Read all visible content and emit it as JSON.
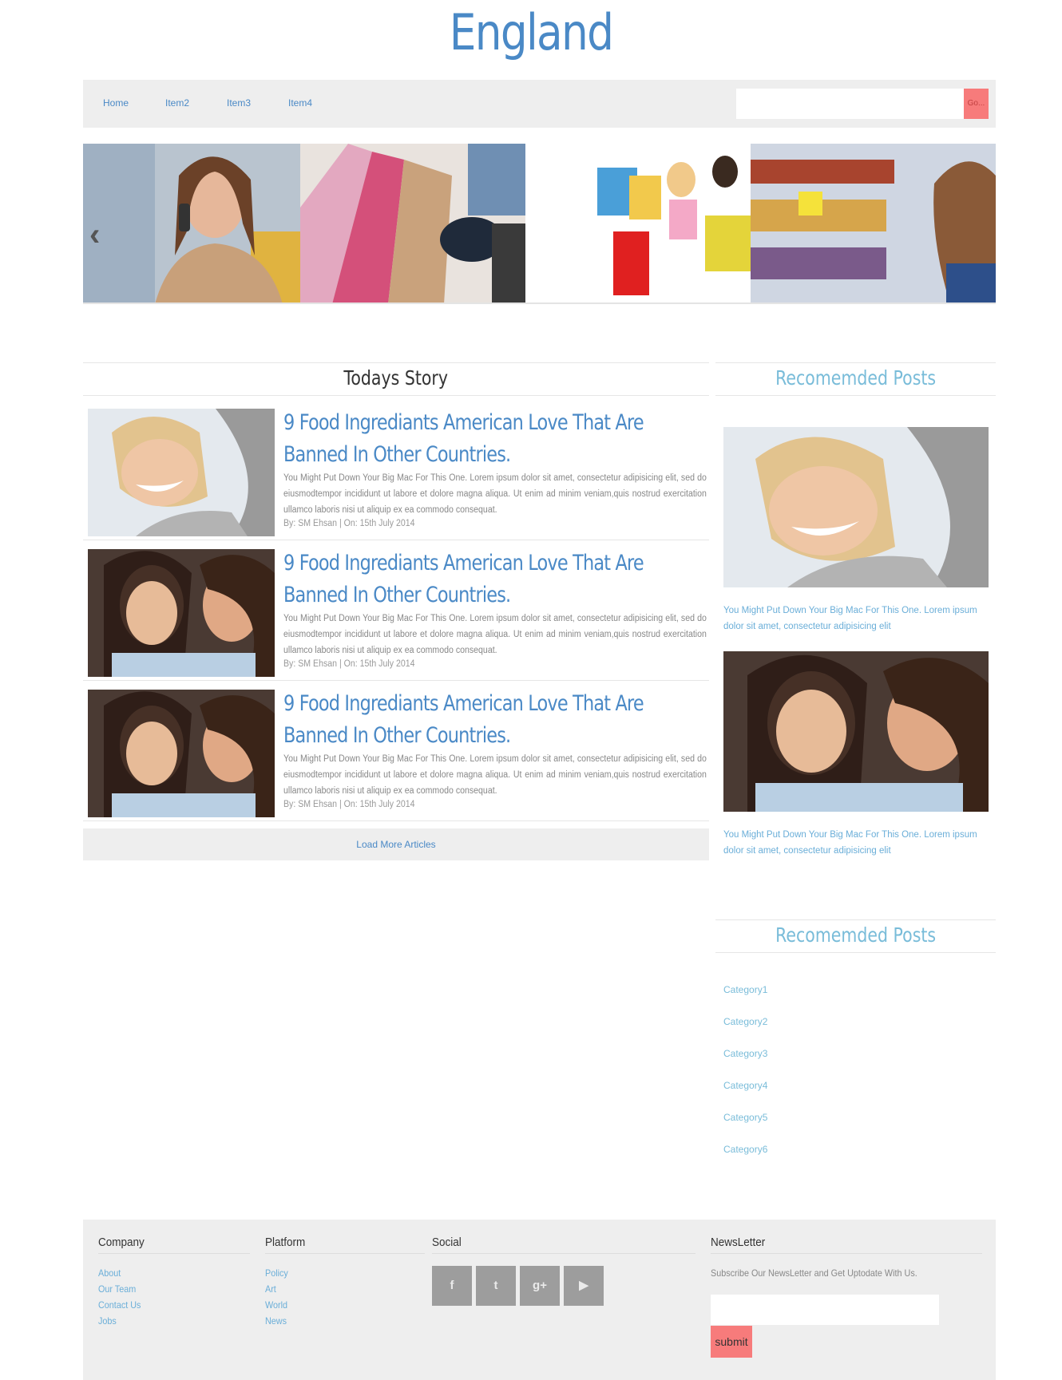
{
  "site": {
    "title": "England"
  },
  "nav": {
    "items": [
      "Home",
      "Item2",
      "Item3",
      "Item4"
    ],
    "search_placeholder": "",
    "go_label": "Go..."
  },
  "carousel": {
    "prev_icon": "chevron-left-icon"
  },
  "todays_story": {
    "heading": "Todays Story",
    "articles": [
      {
        "title": "9 Food Ingrediants American Love That Are Banned In Other Countries.",
        "body": "You Might Put Down Your Big Mac For This One. Lorem ipsum dolor sit amet, consectetur adipisicing elit, sed do eiusmodtempor incididunt ut labore et dolore magna aliqua. Ut enim ad minim veniam,quis nostrud exercitation ullamco laboris nisi ut aliquip ex ea commodo consequat.",
        "meta": "By: SM Ehsan | On: 15th July 2014"
      },
      {
        "title": "9 Food Ingrediants American Love That Are Banned In Other Countries.",
        "body": "You Might Put Down Your Big Mac For This One. Lorem ipsum dolor sit amet, consectetur adipisicing elit, sed do eiusmodtempor incididunt ut labore et dolore magna aliqua. Ut enim ad minim veniam,quis nostrud exercitation ullamco laboris nisi ut aliquip ex ea commodo consequat.",
        "meta": "By: SM Ehsan | On: 15th July 2014"
      },
      {
        "title": "9 Food Ingrediants American Love That Are Banned In Other Countries.",
        "body": "You Might Put Down Your Big Mac For This One. Lorem ipsum dolor sit amet, consectetur adipisicing elit, sed do eiusmodtempor incididunt ut labore et dolore magna aliqua. Ut enim ad minim veniam,quis nostrud exercitation ullamco laboris nisi ut aliquip ex ea commodo consequat.",
        "meta": "By: SM Ehsan | On: 15th July 2014"
      }
    ],
    "load_more": "Load More Articles"
  },
  "recommended": {
    "heading": "Recomemded Posts",
    "posts": [
      {
        "text": "You Might Put Down Your Big Mac For This One. Lorem ipsum dolor sit amet, consectetur adipisicing elit"
      },
      {
        "text": "You Might Put Down Your Big Mac For This One. Lorem ipsum dolor sit amet, consectetur adipisicing elit"
      }
    ]
  },
  "categories": {
    "heading": "Recomemded Posts",
    "items": [
      "Category1",
      "Category2",
      "Category3",
      "Category4",
      "Category5",
      "Category6"
    ]
  },
  "footer": {
    "company": {
      "title": "Company",
      "links": [
        "About",
        "Our Team",
        "Contact Us",
        "Jobs"
      ]
    },
    "platform": {
      "title": "Platform",
      "links": [
        "Policy",
        "Art",
        "World",
        "News"
      ]
    },
    "social": {
      "title": "Social",
      "icons": [
        "facebook-icon",
        "twitter-icon",
        "google-plus-icon",
        "youtube-icon"
      ],
      "glyphs": [
        "f",
        "t",
        "g+",
        "▶"
      ]
    },
    "newsletter": {
      "title": "NewsLetter",
      "text": "Subscribe Our NewsLetter and Get Uptodate With Us.",
      "submit": "submit"
    }
  },
  "colors": {
    "brand": "#4a89c6",
    "accent": "#f77b7b",
    "panel": "#eeeeee",
    "light_blue": "#79bcd9"
  }
}
